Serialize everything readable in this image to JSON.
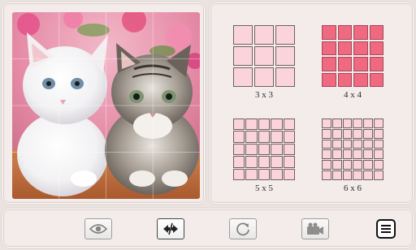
{
  "game": {
    "grid_options": [
      {
        "label": "3 x 3",
        "n": 3,
        "selected": false
      },
      {
        "label": "4 x 4",
        "n": 4,
        "selected": true
      },
      {
        "label": "5 x 5",
        "n": 5,
        "selected": false
      },
      {
        "label": "6 x 6",
        "n": 6,
        "selected": false
      }
    ],
    "current_grid": 4
  },
  "toolbar": {
    "buttons": [
      {
        "name": "preview-button",
        "icon": "eye-icon"
      },
      {
        "name": "swap-button",
        "icon": "swap-arrows-icon"
      },
      {
        "name": "shuffle-button",
        "icon": "rotate-icon"
      },
      {
        "name": "camera-button",
        "icon": "camera-icon"
      }
    ],
    "menu_icon": "menu-icon"
  },
  "colors": {
    "cell_light": "#fbd3db",
    "cell_selected": "#ef6a80",
    "cell_selected_border": "#a84455",
    "background": "#ebe3e0",
    "panel": "#f4eceb"
  }
}
